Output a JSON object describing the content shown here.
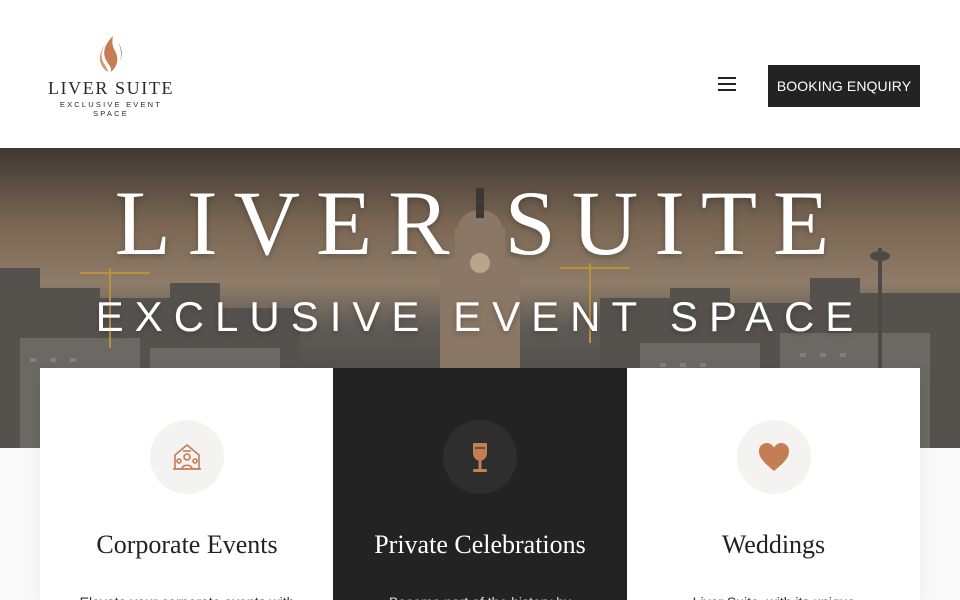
{
  "header": {
    "logo_title": "LIVER SUITE",
    "logo_subtitle": "EXCLUSIVE EVENT SPACE",
    "logo_icon": "flame-logo-icon",
    "menu_icon": "hamburger-menu-icon",
    "booking_label": "BOOKING ENQUIRY"
  },
  "hero": {
    "title": "LIVER SUITE",
    "subtitle": "EXCLUSIVE EVENT SPACE"
  },
  "cards": [
    {
      "title": "Corporate Events",
      "icon": "building-people-icon",
      "excerpt": "Elevate your corporate events with"
    },
    {
      "title": "Private Celebrations",
      "icon": "wine-glass-icon",
      "excerpt": "Become part of the history by"
    },
    {
      "title": "Weddings",
      "icon": "heart-icon",
      "excerpt": "Liver Suite, with its unique"
    }
  ],
  "colors": {
    "accent": "#c47d55",
    "dark": "#232323",
    "text": "#222222"
  }
}
